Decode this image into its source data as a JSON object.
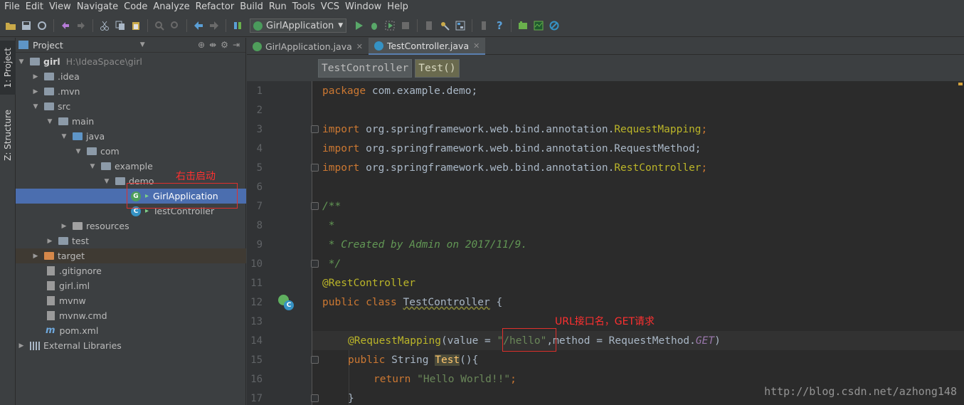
{
  "menu": [
    "File",
    "Edit",
    "View",
    "Navigate",
    "Code",
    "Analyze",
    "Refactor",
    "Build",
    "Run",
    "Tools",
    "VCS",
    "Window",
    "Help"
  ],
  "toolbar": {
    "run_config": "GirlApplication",
    "help_glyph": "?"
  },
  "left_strip": {
    "project_tab": "1: Project",
    "structure_tab": "Z: Structure"
  },
  "project_panel": {
    "title": "Project",
    "tree": [
      {
        "label": "girl",
        "path": "H:\\IdeaSpace\\girl"
      },
      {
        "label": ".idea"
      },
      {
        "label": ".mvn"
      },
      {
        "label": "src"
      },
      {
        "label": "main"
      },
      {
        "label": "java"
      },
      {
        "label": "com"
      },
      {
        "label": "example"
      },
      {
        "label": "demo"
      },
      {
        "label": "GirlApplication"
      },
      {
        "label": "TestController"
      },
      {
        "label": "resources"
      },
      {
        "label": "test"
      },
      {
        "label": "target"
      },
      {
        "label": ".gitignore"
      },
      {
        "label": "girl.iml"
      },
      {
        "label": "mvnw"
      },
      {
        "label": "mvnw.cmd"
      },
      {
        "label": "pom.xml"
      },
      {
        "label": "External Libraries"
      }
    ]
  },
  "annotations": {
    "right_click_start": "右击启动",
    "url_note": "URL接口名，GET请求"
  },
  "editor": {
    "tabs": [
      {
        "label": "GirlApplication.java"
      },
      {
        "label": "TestController.java"
      }
    ],
    "breadcrumbs": [
      "TestController",
      "Test()"
    ],
    "line_numbers": [
      "1",
      "2",
      "3",
      "4",
      "5",
      "6",
      "7",
      "8",
      "9",
      "10",
      "11",
      "12",
      "13",
      "14",
      "15",
      "16",
      "17"
    ],
    "code": {
      "l1_kw": "package",
      "l1_rest": " com.example.demo;",
      "import_kw": "import",
      "l3_pkg": " org.springframework.web.bind.annotation.",
      "l3_cls": "RequestMapping",
      "l3_end": ";",
      "l4_rest": " org.springframework.web.bind.annotation.RequestMethod;",
      "l5_pkg": " org.springframework.web.bind.annotation.",
      "l5_cls": "RestController",
      "l5_end": ";",
      "l7": "/**",
      "l8": " *",
      "l9": " * Created by Admin on 2017/11/9.",
      "l10": " */",
      "l11": "@RestController",
      "l12_kw": "public class",
      "l12_cls": "TestController",
      "l12_end": " {",
      "l14_ann": "@RequestMapping",
      "l14_a": "(value = ",
      "l14_str": "\"/hello\"",
      "l14_b": ",method = RequestMethod.",
      "l14_field": "GET",
      "l14_c": ")",
      "l15_kw": "public",
      "l15_type": " String ",
      "l15_method": "Test",
      "l15_end": "(){",
      "l16_kw": "return",
      "l16_str": "\"Hello World!!\"",
      "l16_end": ";",
      "l17": "}"
    }
  },
  "watermark": "http://blog.csdn.net/azhong148"
}
